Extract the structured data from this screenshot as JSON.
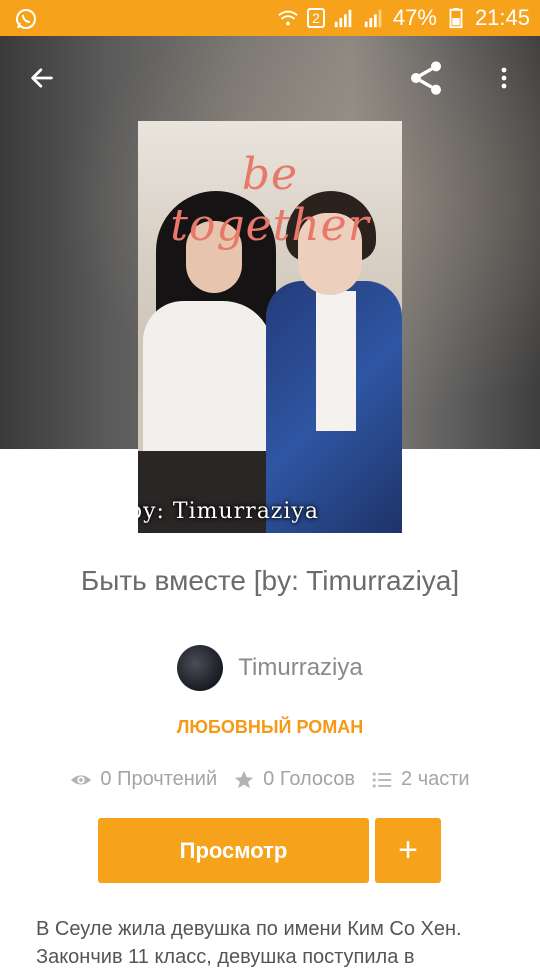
{
  "status_bar": {
    "battery": "47%",
    "time": "21:45",
    "sim_label": "2"
  },
  "toolbar": {
    "back_icon": "arrow-left-icon",
    "share_icon": "share-icon",
    "more_icon": "more-vertical-icon"
  },
  "cover": {
    "title_text": "be together",
    "byline_text": "by: Timurraziya"
  },
  "story": {
    "title": "Быть вместе  [by: Timurraziya]",
    "author": "Timurraziya",
    "genre": "ЛЮБОВНЫЙ РОМАН",
    "stats": {
      "reads": "0 Прочтений",
      "votes": "0 Голосов",
      "parts": "2 части"
    },
    "description": "В Сеуле жила девушка по имени Ким Со Хен. Закончив 11 класс, девушка поступила в"
  },
  "actions": {
    "view_label": "Просмотр",
    "add_label": "+"
  },
  "colors": {
    "accent": "#f7a21b",
    "genre": "#f59a14"
  }
}
